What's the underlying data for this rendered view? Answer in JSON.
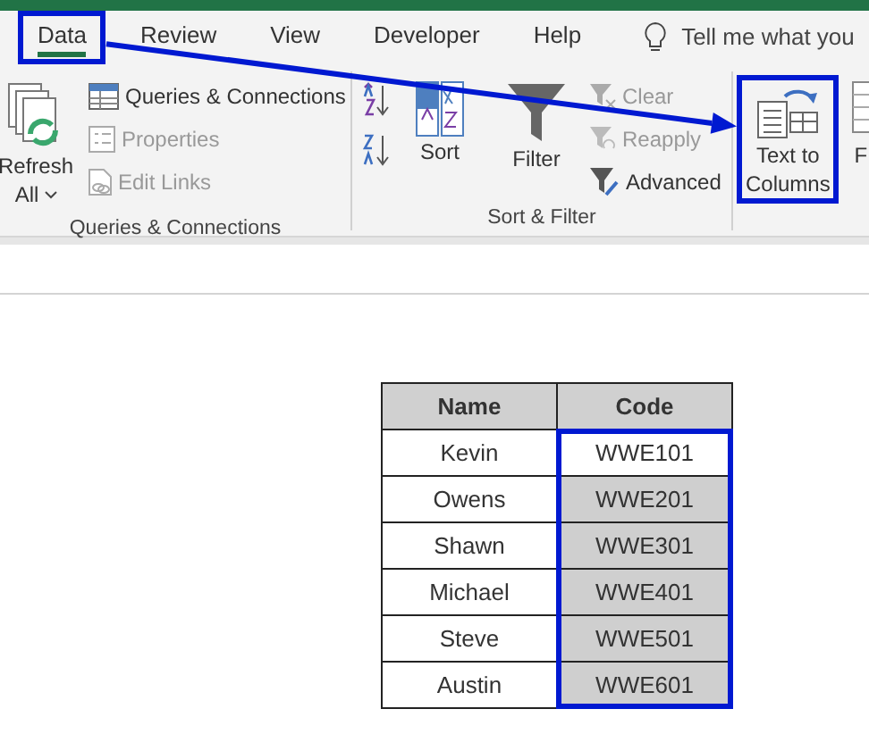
{
  "tabs": [
    {
      "label": "Data",
      "selected": true,
      "highlighted": true
    },
    {
      "label": "Review",
      "selected": false,
      "highlighted": false
    },
    {
      "label": "View",
      "selected": false,
      "highlighted": false
    },
    {
      "label": "Developer",
      "selected": false,
      "highlighted": false
    },
    {
      "label": "Help",
      "selected": false,
      "highlighted": false
    }
  ],
  "tell_me": "Tell me what you",
  "groups": [
    {
      "label": "Queries & Connections",
      "items": [
        {
          "kind": "big",
          "label": "Refresh",
          "sublabel": "All",
          "dropdown": true,
          "disabled": false,
          "highlighted": false
        },
        {
          "kind": "small",
          "label": "Queries & Connections",
          "disabled": false
        },
        {
          "kind": "small",
          "label": "Properties",
          "disabled": true
        },
        {
          "kind": "small",
          "label": "Edit Links",
          "disabled": true
        }
      ]
    },
    {
      "label": "Sort & Filter",
      "items": [
        {
          "kind": "sortpair"
        },
        {
          "kind": "big",
          "label": "Sort",
          "disabled": false,
          "highlighted": false
        },
        {
          "kind": "big",
          "label": "Filter",
          "disabled": false,
          "highlighted": false
        },
        {
          "kind": "small",
          "label": "Clear",
          "disabled": true
        },
        {
          "kind": "small",
          "label": "Reapply",
          "disabled": true
        },
        {
          "kind": "small",
          "label": "Advanced",
          "disabled": false
        }
      ]
    },
    {
      "items": [
        {
          "kind": "big",
          "label": "Text to",
          "sublabel": "Columns",
          "disabled": false,
          "highlighted": true
        },
        {
          "kind": "partial",
          "label": "F"
        }
      ]
    }
  ],
  "table": {
    "columns": [
      "Name",
      "Code"
    ],
    "rows": [
      {
        "name": "Kevin",
        "code": "WWE101",
        "selected": true,
        "active": true
      },
      {
        "name": "Owens",
        "code": "WWE201",
        "selected": true,
        "active": false
      },
      {
        "name": "Shawn",
        "code": "WWE301",
        "selected": true,
        "active": false
      },
      {
        "name": "Michael",
        "code": "WWE401",
        "selected": true,
        "active": false
      },
      {
        "name": "Steve",
        "code": "WWE501",
        "selected": true,
        "active": false
      },
      {
        "name": "Austin",
        "code": "WWE601",
        "selected": true,
        "active": false
      }
    ]
  }
}
